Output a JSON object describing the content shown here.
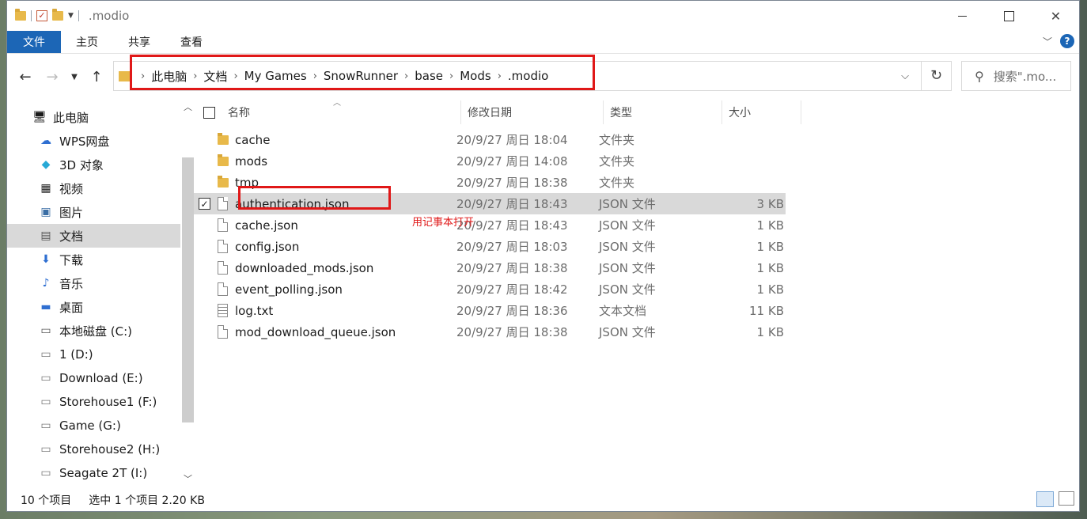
{
  "window": {
    "title": ".modio",
    "controls": {
      "minimize": "—",
      "maximize": "☐",
      "close": "✕"
    }
  },
  "ribbon": {
    "tabs": [
      "文件",
      "主页",
      "共享",
      "查看"
    ]
  },
  "address": {
    "crumbs": [
      "此电脑",
      "文档",
      "My Games",
      "SnowRunner",
      "base",
      "Mods",
      ".modio"
    ],
    "search_placeholder": "搜索\".mo..."
  },
  "sidebar": {
    "items": [
      {
        "label": "此电脑",
        "icon": "computer-icon"
      },
      {
        "label": "WPS网盘",
        "icon": "cloud-icon"
      },
      {
        "label": "3D 对象",
        "icon": "cube-icon"
      },
      {
        "label": "视频",
        "icon": "video-icon"
      },
      {
        "label": "图片",
        "icon": "picture-icon"
      },
      {
        "label": "文档",
        "icon": "document-icon",
        "selected": true
      },
      {
        "label": "下载",
        "icon": "download-icon"
      },
      {
        "label": "音乐",
        "icon": "music-icon"
      },
      {
        "label": "桌面",
        "icon": "desktop-icon"
      },
      {
        "label": "本地磁盘 (C:)",
        "icon": "system-drive-icon"
      },
      {
        "label": "1 (D:)",
        "icon": "drive-icon"
      },
      {
        "label": "Download (E:)",
        "icon": "drive-icon"
      },
      {
        "label": "Storehouse1 (F:)",
        "icon": "drive-icon"
      },
      {
        "label": "Game (G:)",
        "icon": "drive-icon"
      },
      {
        "label": "Storehouse2 (H:)",
        "icon": "drive-icon"
      },
      {
        "label": "Seagate 2T (I:)",
        "icon": "drive-icon"
      }
    ]
  },
  "columns": {
    "name": "名称",
    "date": "修改日期",
    "type": "类型",
    "size": "大小"
  },
  "files": [
    {
      "name": "cache",
      "date": "20/9/27 周日 18:04",
      "type": "文件夹",
      "size": "",
      "kind": "folder"
    },
    {
      "name": "mods",
      "date": "20/9/27 周日 14:08",
      "type": "文件夹",
      "size": "",
      "kind": "folder"
    },
    {
      "name": "tmp",
      "date": "20/9/27 周日 18:38",
      "type": "文件夹",
      "size": "",
      "kind": "folder"
    },
    {
      "name": "authentication.json",
      "date": "20/9/27 周日 18:43",
      "type": "JSON 文件",
      "size": "3 KB",
      "kind": "file",
      "selected": true
    },
    {
      "name": "cache.json",
      "date": "20/9/27 周日 18:43",
      "type": "JSON 文件",
      "size": "1 KB",
      "kind": "file"
    },
    {
      "name": "config.json",
      "date": "20/9/27 周日 18:03",
      "type": "JSON 文件",
      "size": "1 KB",
      "kind": "file"
    },
    {
      "name": "downloaded_mods.json",
      "date": "20/9/27 周日 18:38",
      "type": "JSON 文件",
      "size": "1 KB",
      "kind": "file"
    },
    {
      "name": "event_polling.json",
      "date": "20/9/27 周日 18:42",
      "type": "JSON 文件",
      "size": "1 KB",
      "kind": "file"
    },
    {
      "name": "log.txt",
      "date": "20/9/27 周日 18:36",
      "type": "文本文档",
      "size": "11 KB",
      "kind": "text"
    },
    {
      "name": "mod_download_queue.json",
      "date": "20/9/27 周日 18:38",
      "type": "JSON 文件",
      "size": "1 KB",
      "kind": "file"
    }
  ],
  "annotation": {
    "text": "用记事本打开",
    "color": "#e01818"
  },
  "status": {
    "count": "10 个项目",
    "selection": "选中 1 个项目  2.20 KB"
  },
  "colors": {
    "accent": "#1c66b6",
    "highlight": "#e01818",
    "selection": "#d9d9d9"
  }
}
